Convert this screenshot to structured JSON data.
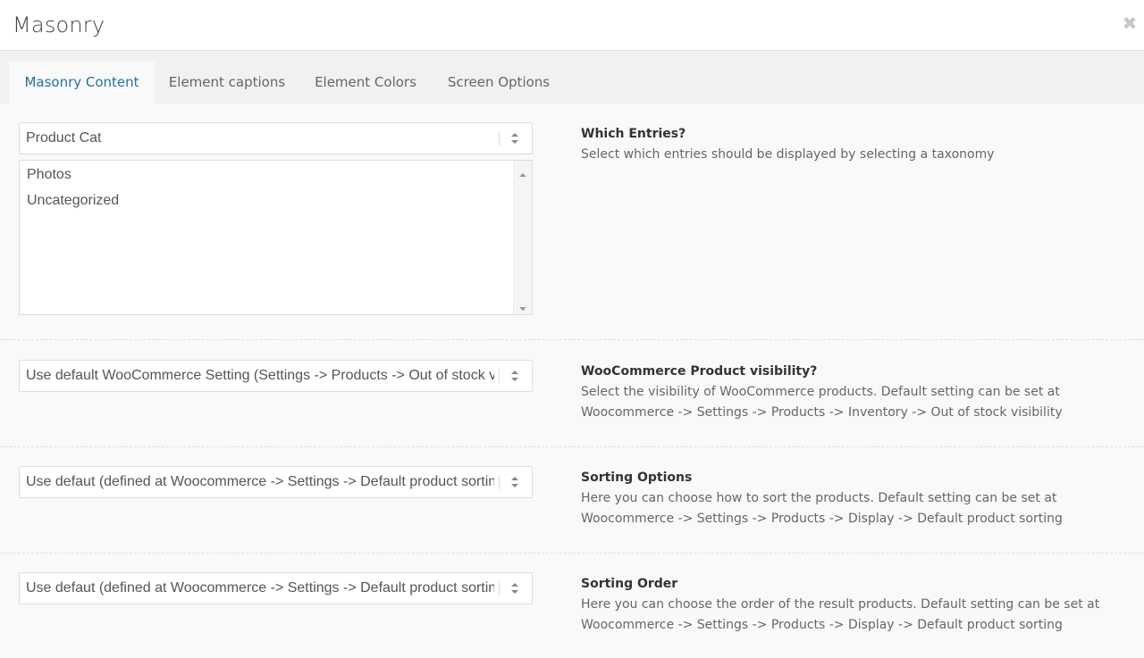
{
  "window": {
    "title": "Masonry"
  },
  "tabs": [
    {
      "label": "Masonry Content",
      "active": true
    },
    {
      "label": "Element captions",
      "active": false
    },
    {
      "label": "Element Colors",
      "active": false
    },
    {
      "label": "Screen Options",
      "active": false
    }
  ],
  "sections": [
    {
      "select_value": "Product Cat",
      "list_items": [
        "Photos",
        "Uncategorized"
      ],
      "heading": "Which Entries?",
      "description": [
        "Select which entries should be displayed by selecting a taxonomy"
      ]
    },
    {
      "select_value": "Use default WooCommerce Setting (Settings -> Products -> Out of stock visibility)",
      "heading": "WooCommerce Product visibility?",
      "description": [
        "Select the visibility of WooCommerce products. Default setting can be set at",
        "Woocommerce -> Settings -> Products -> Inventory -> Out of stock visibility"
      ]
    },
    {
      "select_value": "Use defaut (defined at Woocommerce -> Settings -> Default product sorting)",
      "heading": "Sorting Options",
      "description": [
        "Here you can choose how to sort the products. Default setting can be set at",
        "Woocommerce -> Settings -> Products -> Display -> Default product sorting"
      ]
    },
    {
      "select_value": "Use defaut (defined at Woocommerce -> Settings -> Default product sorting)",
      "heading": "Sorting Order",
      "description": [
        "Here you can choose the order of the result products. Default setting can be set at",
        "Woocommerce -> Settings -> Products -> Display -> Default product sorting"
      ]
    }
  ],
  "icons": {
    "close": "close-icon",
    "select_arrows": "select-arrows-icon",
    "scroll_up": "scroll-up-icon",
    "scroll_down": "scroll-down-icon"
  },
  "colors": {
    "accent": "#2a6f9f",
    "tabbar_bg": "#f1f1f1",
    "content_bg": "#f9f9f9"
  }
}
